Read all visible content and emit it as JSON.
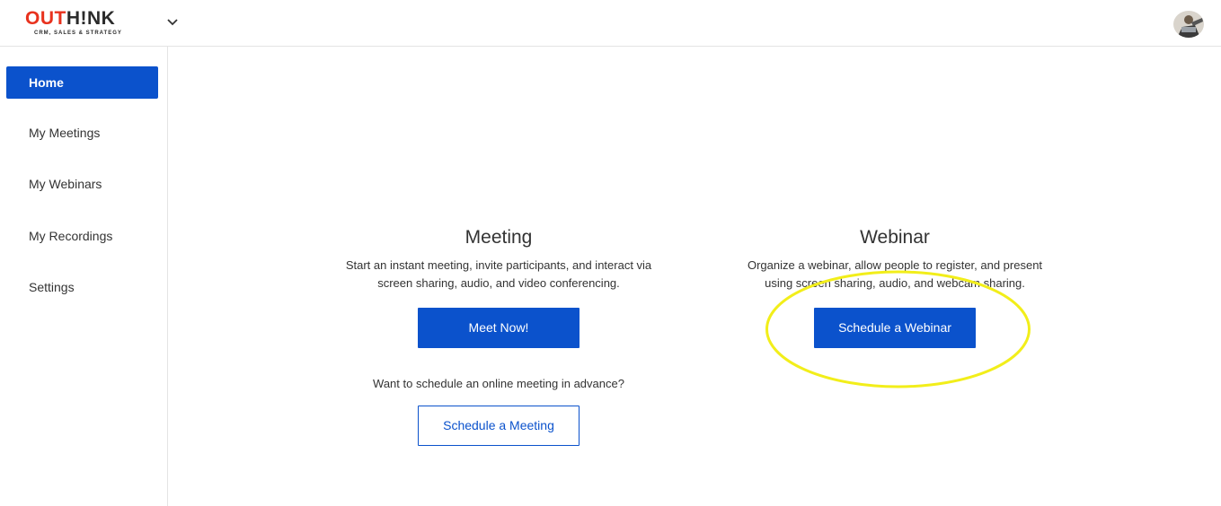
{
  "header": {
    "logo_word_part1": "OU",
    "logo_word_part2": "T",
    "logo_word_part3": "H!NK",
    "logo_tagline": "CRM, SALES & STRATEGY",
    "menu_icon": "chevron-down-icon",
    "avatar_icon": "user-avatar"
  },
  "sidebar": {
    "items": [
      {
        "label": "Home",
        "active": true
      },
      {
        "label": "My Meetings",
        "active": false
      },
      {
        "label": "My Webinars",
        "active": false
      },
      {
        "label": "My Recordings",
        "active": false
      },
      {
        "label": "Settings",
        "active": false
      }
    ]
  },
  "meeting": {
    "title": "Meeting",
    "description_line1": "Start an instant meeting, invite participants, and interact via",
    "description_line2": "screen sharing, audio, and video conferencing.",
    "meet_now_label": "Meet Now!",
    "schedule_prompt": "Want to schedule an online meeting in advance?",
    "schedule_label": "Schedule a Meeting"
  },
  "webinar": {
    "title": "Webinar",
    "description_line1": "Organize a webinar, allow people to register, and present",
    "description_line2": "using screen sharing, audio, and webcam sharing.",
    "schedule_label": "Schedule a Webinar"
  },
  "colors": {
    "accent": "#0b52cc",
    "logo_red": "#e8321e",
    "highlight": "#f2ee1a"
  }
}
